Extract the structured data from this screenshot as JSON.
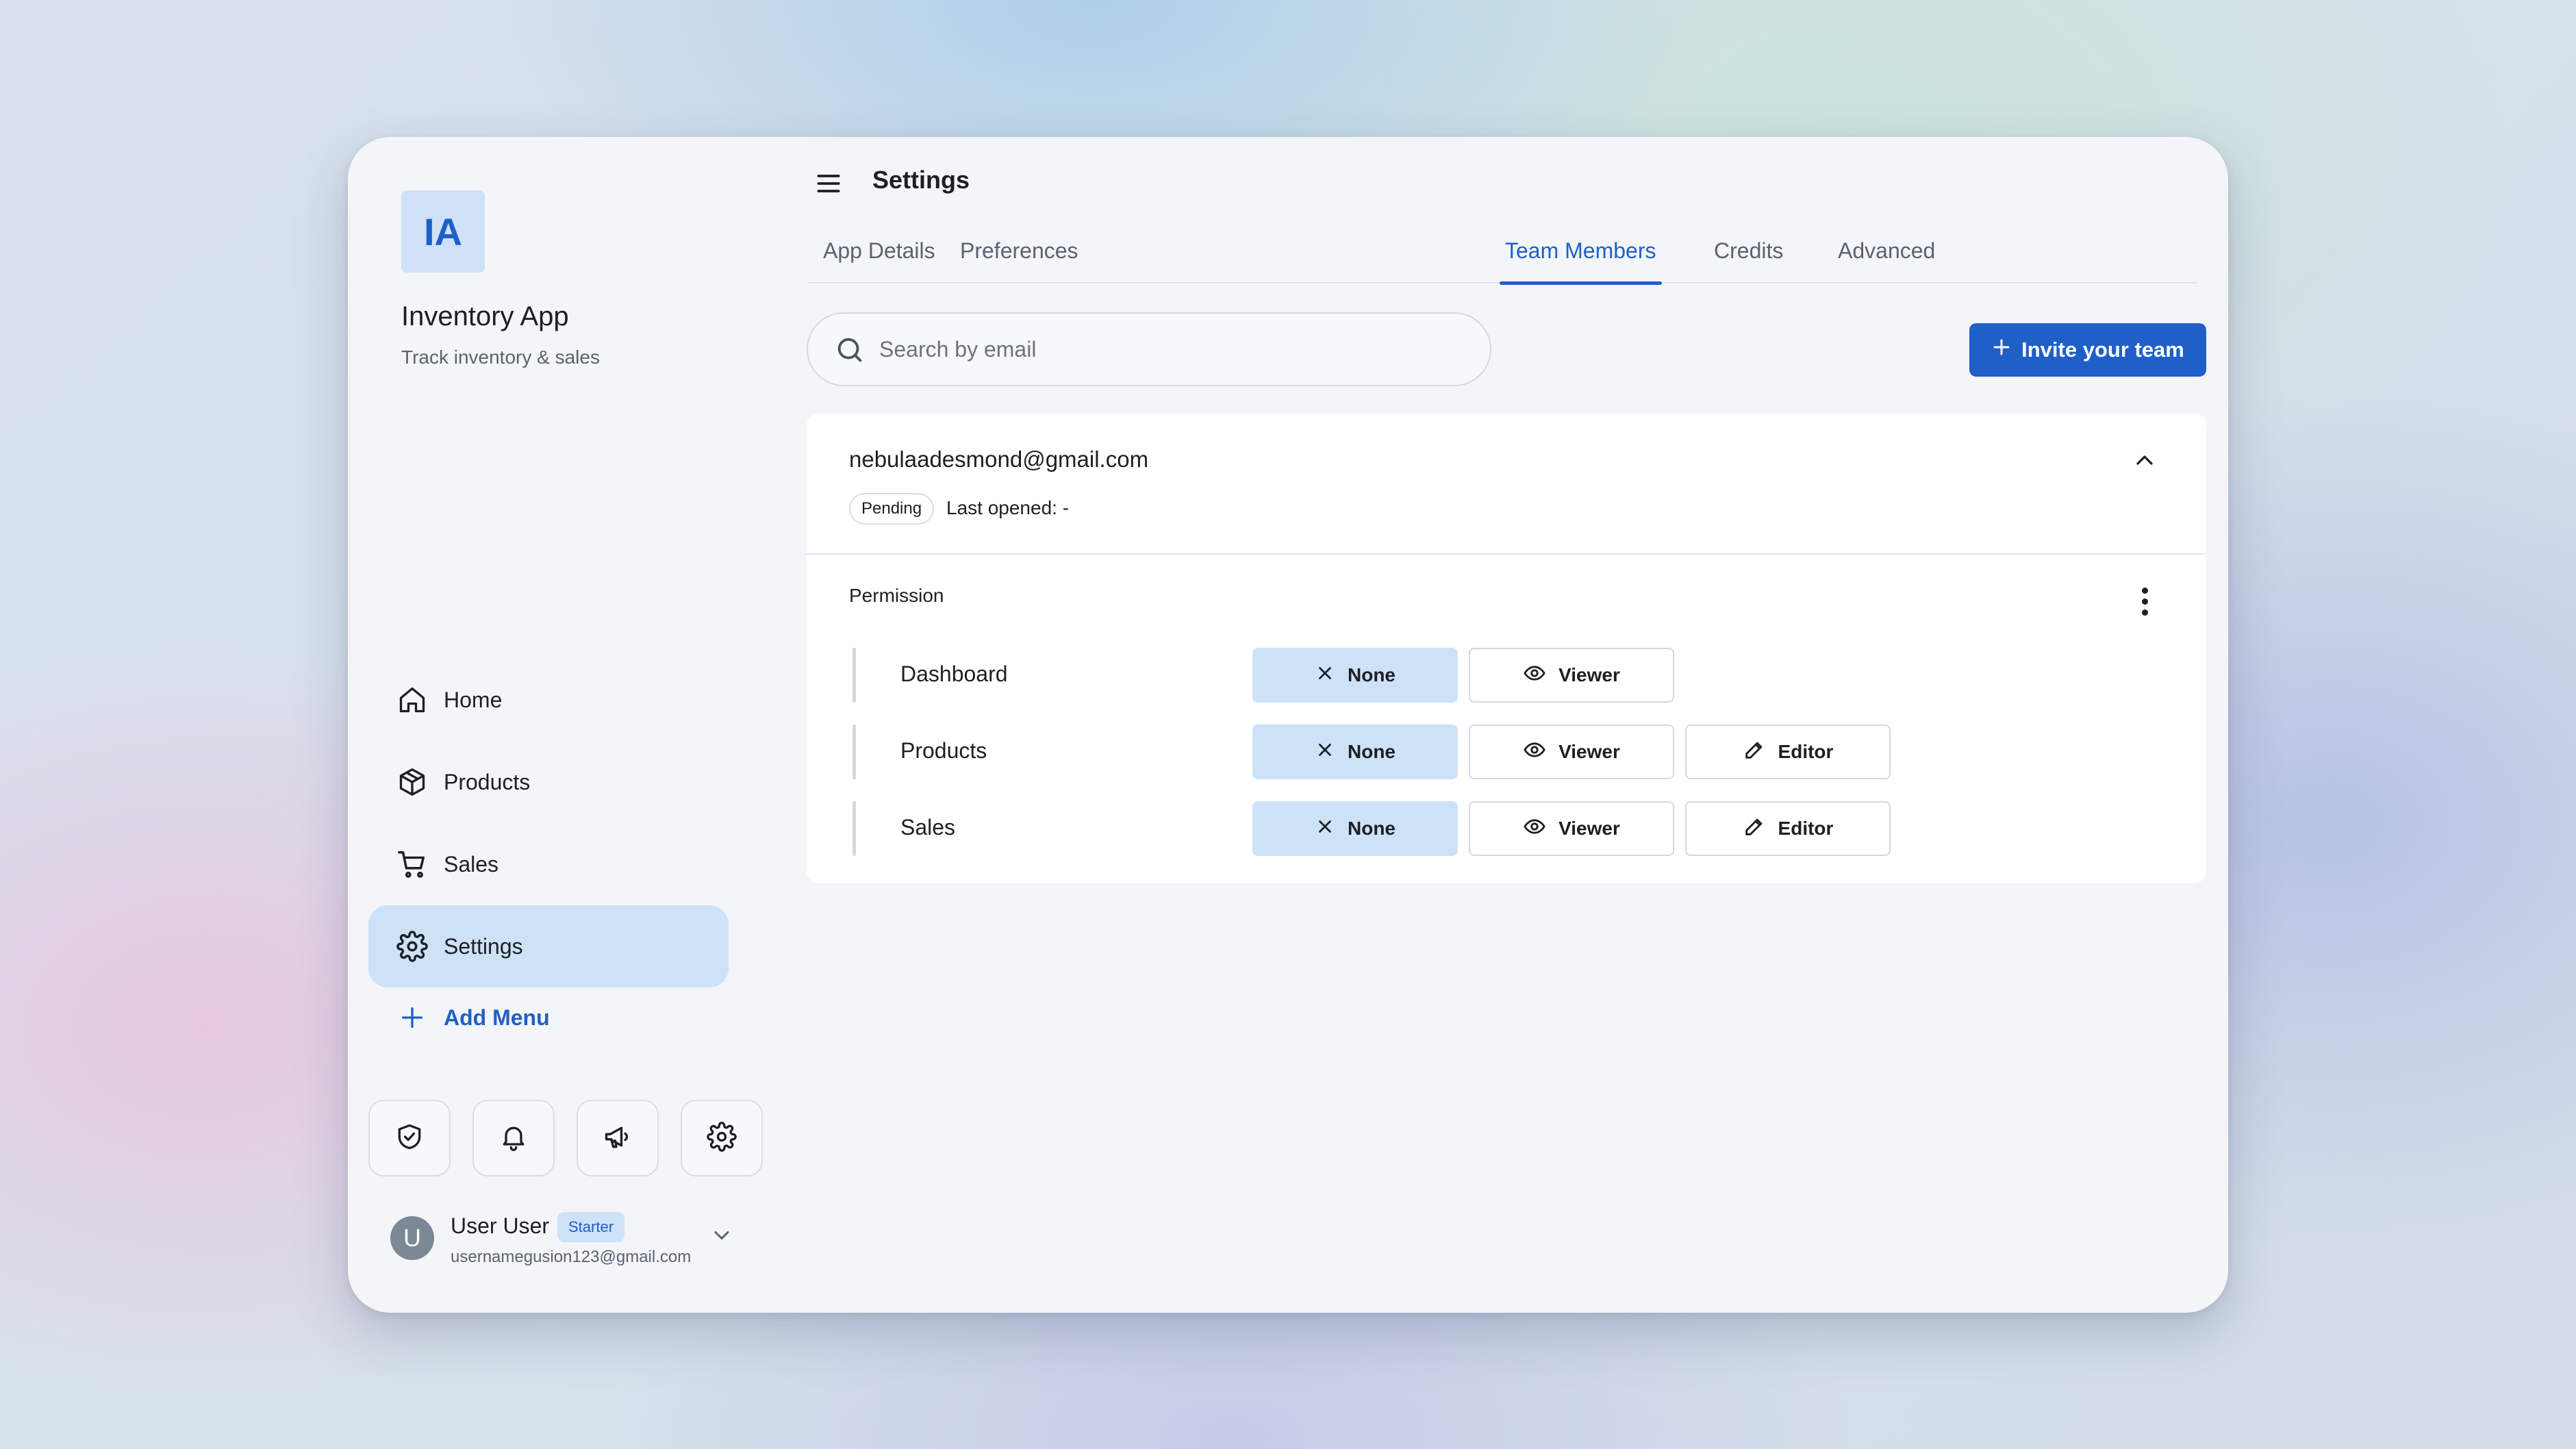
{
  "app": {
    "logo_initials": "IA",
    "name": "Inventory App",
    "subtitle": "Track inventory & sales"
  },
  "sidebar": {
    "items": [
      {
        "label": "Home",
        "icon": "home-icon"
      },
      {
        "label": "Products",
        "icon": "box-icon"
      },
      {
        "label": "Sales",
        "icon": "cart-icon"
      },
      {
        "label": "Settings",
        "icon": "gear-icon",
        "active": true
      }
    ],
    "add_menu_label": "Add Menu",
    "quick_actions": [
      "shield-check-icon",
      "bell-icon",
      "megaphone-icon",
      "gear-icon"
    ]
  },
  "user": {
    "avatar_initial": "U",
    "name": "User User",
    "plan_badge": "Starter",
    "email": "usernamegusion123@gmail.com"
  },
  "header": {
    "title": "Settings"
  },
  "tabs": [
    {
      "label": "App Details"
    },
    {
      "label": "Preferences"
    },
    {
      "label": "Team Members",
      "active": true
    },
    {
      "label": "Credits"
    },
    {
      "label": "Advanced"
    }
  ],
  "search": {
    "placeholder": "Search by email",
    "value": ""
  },
  "invite_button_label": "Invite your team",
  "member": {
    "email": "nebulaadesmond@gmail.com",
    "status": "Pending",
    "last_opened": "Last opened: -",
    "permission_label": "Permission",
    "permissions": [
      {
        "name": "Dashboard",
        "options": [
          "None",
          "Viewer"
        ],
        "selected": "None"
      },
      {
        "name": "Products",
        "options": [
          "None",
          "Viewer",
          "Editor"
        ],
        "selected": "None"
      },
      {
        "name": "Sales",
        "options": [
          "None",
          "Viewer",
          "Editor"
        ],
        "selected": "None"
      }
    ]
  },
  "colors": {
    "accent": "#1f5fc8",
    "active_bg": "#cde2f7",
    "window_bg": "#f3f5f8"
  }
}
